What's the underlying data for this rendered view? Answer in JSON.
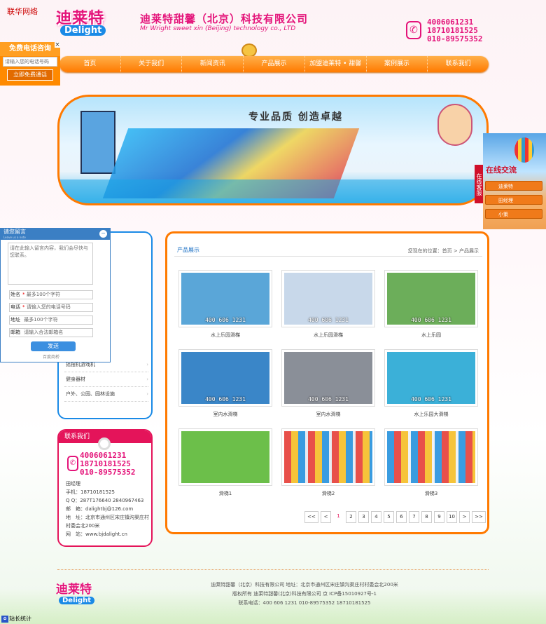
{
  "watermark": "联华网络",
  "logo": {
    "cn": "迪莱特",
    "en": "Delight"
  },
  "company": {
    "cn": "迪莱特甜馨（北京）科技有限公司",
    "en": "Mr Wright sweet xin (Beijing) technology co., LTD"
  },
  "header_phones": [
    "4006061231",
    "18710181525",
    "010-89575352"
  ],
  "nav": [
    "首页",
    "关于我们",
    "新闻资讯",
    "产品展示",
    "加盟迪莱特 • 甜馨",
    "案例展示",
    "联系我们"
  ],
  "float_phone": {
    "title": "免费电话咨询",
    "placeholder": "请输入您的电话号码",
    "button": "立即免费通话"
  },
  "banner": {
    "slogan": "专业品质 创造卓越"
  },
  "online": {
    "title": "在线交流",
    "tab": "在线客服",
    "items": [
      "迪莱特",
      "田经理",
      "小策"
    ]
  },
  "message": {
    "title": "请您留言",
    "subtitle": "Leave us a note",
    "textarea_placeholder": "请在此输入留言内容，我们会尽快与您联系。",
    "fields": [
      {
        "label": "姓名",
        "required": true,
        "placeholder": "最多100个字符"
      },
      {
        "label": "电话",
        "required": true,
        "placeholder": "请输入您的电话号码"
      },
      {
        "label": "地址",
        "required": false,
        "placeholder": "最多100个字符"
      },
      {
        "label": "邮箱",
        "required": false,
        "placeholder": "请输入合法邮箱名"
      }
    ],
    "send": "发送",
    "powered": "百度商桥"
  },
  "categories": [
    "摇摆机游戏机",
    "健身器材",
    "户外、公园、园林设施"
  ],
  "contact": {
    "title": "联系我们",
    "phones": [
      "4006061231",
      "18710181525",
      "010-89575352"
    ],
    "lines": [
      "田经理",
      "手机：18710181525",
      "Q Q：287T176640 2840967463",
      "邮　箱：dalightbj@126.com",
      "地　址：北京市通州区宋庄镇沟渠庄村村委会北200米",
      "网　站：www.bjdalight.cn"
    ]
  },
  "main": {
    "title": "产品展示",
    "breadcrumb": "您现在的位置：首页 > 产品展示",
    "watermark_text": "400 606 1231",
    "products": [
      {
        "name": "水上乐园滑梯",
        "color": "#5aa6d8"
      },
      {
        "name": "水上乐园滑梯",
        "color": "#c8d8ea"
      },
      {
        "name": "水上乐园",
        "color": "#6cae5a"
      },
      {
        "name": "室内水滑梯",
        "color": "#3a86c8"
      },
      {
        "name": "室内水滑梯",
        "color": "#8a8f98"
      },
      {
        "name": "水上乐园大滑梯",
        "color": "#3bb0d8"
      },
      {
        "name": "滑梯1",
        "color": "#6cbf4a"
      },
      {
        "name": "滑梯2",
        "color": "#e8ecf2"
      },
      {
        "name": "滑梯3",
        "color": "#eef2f6"
      }
    ],
    "pager": [
      "<<",
      "<",
      "1",
      "2",
      "3",
      "4",
      "5",
      "6",
      "7",
      "8",
      "9",
      "10",
      ">",
      ">>"
    ],
    "current_page": "1"
  },
  "footer": {
    "line1": "迪莱特甜馨（北京）科技有限公司  地址：北京市通州区宋庄镇沟渠庄村村委会北200米",
    "line2": "版权所有 迪莱特甜馨(北京)科技有限公司 京 ICP备15010927号-1",
    "line3": "联系电话：400 606 1231 010-89575352 18710181525"
  },
  "stat": "站长统计"
}
